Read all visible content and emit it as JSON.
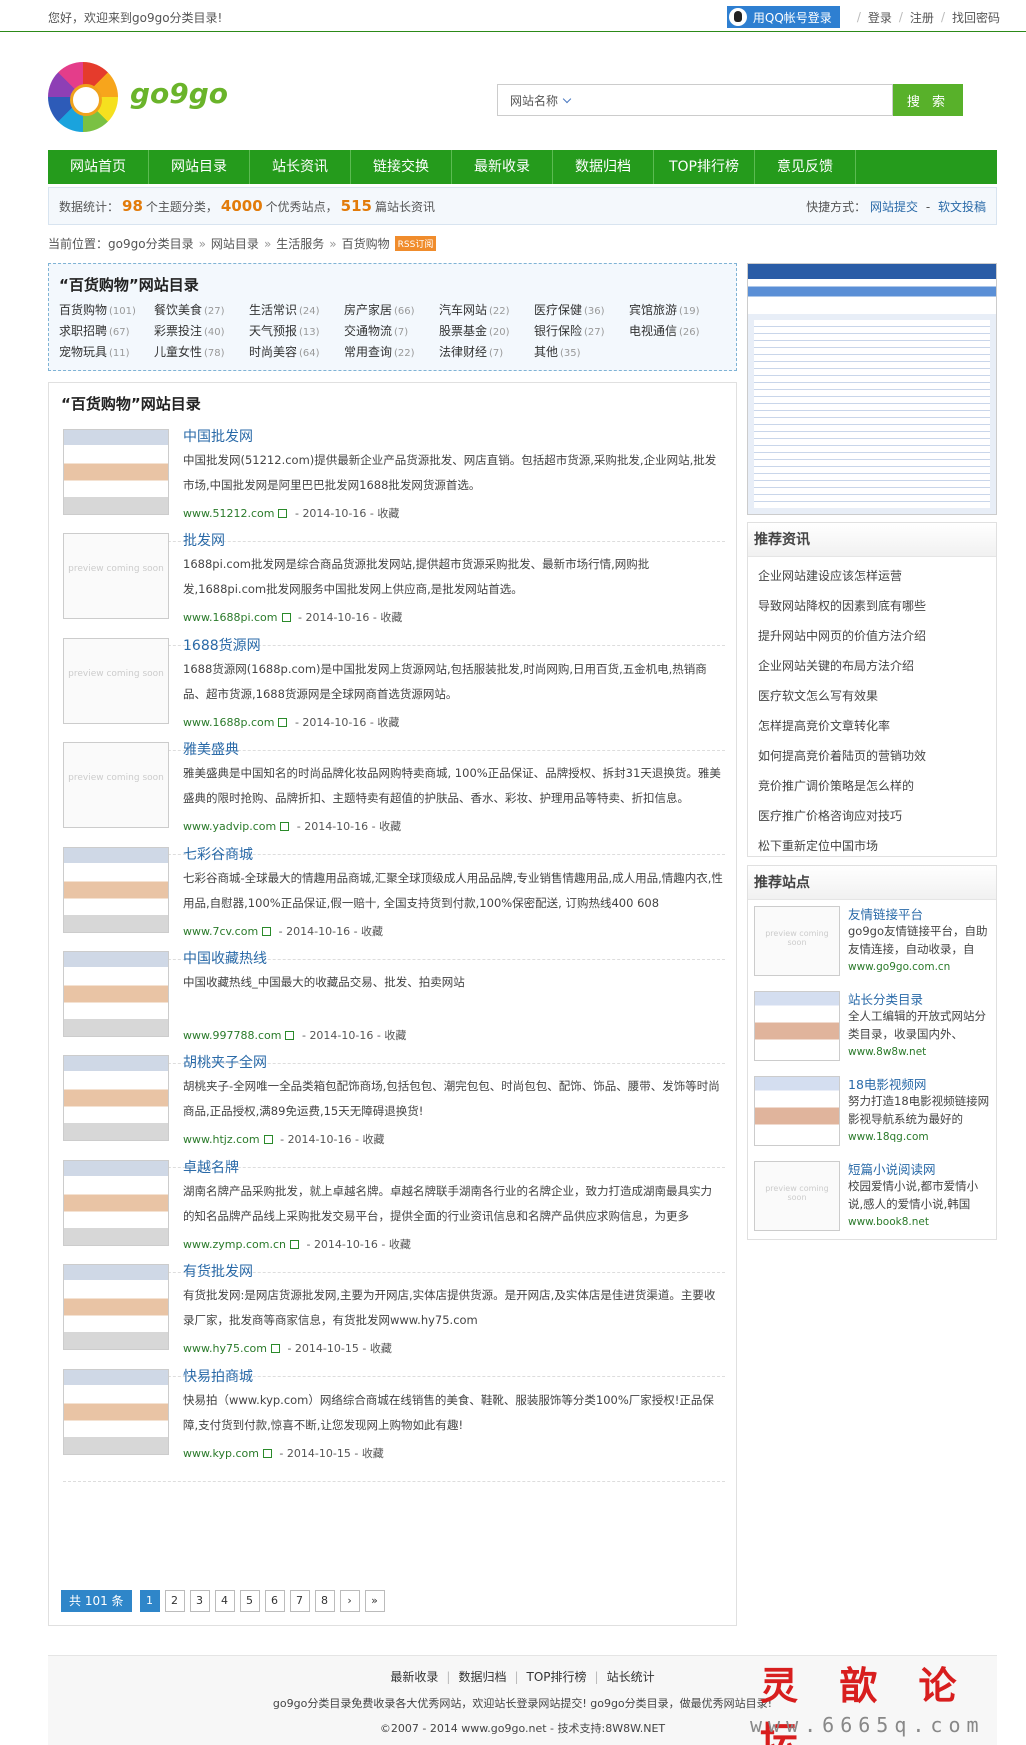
{
  "topbar": {
    "welcome": "您好，欢迎来到go9go分类目录!",
    "qq_login": "用QQ帐号登录",
    "login": "登录",
    "register": "注册",
    "forgot": "找回密码"
  },
  "logo": {
    "text": "go9go"
  },
  "search": {
    "category": "网站名称",
    "placeholder": "",
    "button": "搜 索"
  },
  "nav": [
    "网站首页",
    "网站目录",
    "站长资讯",
    "链接交换",
    "最新收录",
    "数据归档",
    "TOP排行榜",
    "意见反馈"
  ],
  "stats": {
    "label": "数据统计：",
    "categories": "98",
    "categories_text": "个主题分类，",
    "sites": "4000",
    "sites_text": "个优秀站点，",
    "articles": "515",
    "articles_text": "篇站长资讯",
    "quick_label": "快捷方式：",
    "quick_submit": "网站提交",
    "quick_dash": "-",
    "quick_article": "软文投稿"
  },
  "breadcrumb": {
    "label": "当前位置：",
    "items": [
      "go9go分类目录",
      "网站目录",
      "生活服务",
      "百货购物"
    ],
    "badge": "RSS订阅"
  },
  "categories": {
    "title": "“百货购物”网站目录",
    "items": [
      {
        "name": "百货购物",
        "count": "(101)"
      },
      {
        "name": "餐饮美食",
        "count": "(27)"
      },
      {
        "name": "生活常识",
        "count": "(24)"
      },
      {
        "name": "房产家居",
        "count": "(66)"
      },
      {
        "name": "汽车网站",
        "count": "(22)"
      },
      {
        "name": "医疗保健",
        "count": "(36)"
      },
      {
        "name": "宾馆旅游",
        "count": "(19)"
      },
      {
        "name": "求职招聘",
        "count": "(67)"
      },
      {
        "name": "彩票投注",
        "count": "(40)"
      },
      {
        "name": "天气预报",
        "count": "(13)"
      },
      {
        "name": "交通物流",
        "count": "(7)"
      },
      {
        "name": "股票基金",
        "count": "(20)"
      },
      {
        "name": "银行保险",
        "count": "(27)"
      },
      {
        "name": "电视通信",
        "count": "(26)"
      },
      {
        "name": "宠物玩具",
        "count": "(11)"
      },
      {
        "name": "儿童女性",
        "count": "(78)"
      },
      {
        "name": "时尚美容",
        "count": "(64)"
      },
      {
        "name": "常用查询",
        "count": "(22)"
      },
      {
        "name": "法律财经",
        "count": "(7)"
      },
      {
        "name": "其他",
        "count": "(35)"
      }
    ]
  },
  "list": {
    "title": "“百货购物”网站目录",
    "preview_text": "preview coming soon",
    "collect": "收藏",
    "entries": [
      {
        "title": "中国批发网",
        "desc": "中国批发网(51212.com)提供最新企业产品货源批发、网店直销。包括超市货源,采购批发,企业网站,批发市场,中国批发网是阿里巴巴批发网1688批发网货源首选。",
        "url": "www.51212.com",
        "date": "2014-10-16",
        "thumb": "shot"
      },
      {
        "title": "批发网",
        "desc": "1688pi.com批发网是综合商品货源批发网站,提供超市货源采购批发、最新市场行情,网购批发,1688pi.com批发网服务中国批发网上供应商,是批发网站首选。",
        "url": "www.1688pi.com",
        "date": "2014-10-16",
        "thumb": "preview"
      },
      {
        "title": "1688货源网",
        "desc": "1688货源网(1688p.com)是中国批发网上货源网站,包括服装批发,时尚网购,日用百货,五金机电,热销商品、超市货源,1688货源网是全球网商首选货源网站。",
        "url": "www.1688p.com",
        "date": "2014-10-16",
        "thumb": "preview"
      },
      {
        "title": "雅美盛典",
        "desc": "雅美盛典是中国知名的时尚品牌化妆品网购特卖商城, 100%正品保证、品牌授权、拆封31天退换货。雅美盛典的限时抢购、品牌折扣、主题特卖有超值的护肤品、香水、彩妆、护理用品等特卖、折扣信息。",
        "url": "www.yadvip.com",
        "date": "2014-10-16",
        "thumb": "preview"
      },
      {
        "title": "七彩谷商城",
        "desc": "七彩谷商城-全球最大的情趣用品商城,汇聚全球顶级成人用品品牌,专业销售情趣用品,成人用品,情趣内衣,性用品,自慰器,100%正品保证,假一赔十, 全国支持货到付款,100%保密配送, 订购热线400 608",
        "url": "www.7cv.com",
        "date": "2014-10-16",
        "thumb": "shot"
      },
      {
        "title": "中国收藏热线",
        "desc": "中国收藏热线_中国最大的收藏品交易、批发、拍卖网站",
        "url": "www.997788.com",
        "date": "2014-10-16",
        "thumb": "shot"
      },
      {
        "title": "胡桃夹子全网",
        "desc": "胡桃夹子-全网唯一全品类箱包配饰商场,包括包包、潮完包包、时尚包包、配饰、饰品、腰带、发饰等时尚商品,正品授权,满89免运费,15天无障碍退换货!",
        "url": "www.htjz.com",
        "date": "2014-10-16",
        "thumb": "shot"
      },
      {
        "title": "卓越名牌",
        "desc": "湖南名牌产品采购批发，就上卓越名牌。卓越名牌联手湖南各行业的名牌企业，致力打造成湖南最具实力的知名品牌产品线上采购批发交易平台，提供全面的行业资讯信息和名牌产品供应求购信息，为更多",
        "url": "www.zymp.com.cn",
        "date": "2014-10-16",
        "thumb": "shot"
      },
      {
        "title": "有货批发网",
        "desc": "有货批发网:是网店货源批发网,主要为开网店,实体店提供货源。是开网店,及实体店是佳进货渠道。主要收录厂家，批发商等商家信息，有货批发网www.hy75.com",
        "url": "www.hy75.com",
        "date": "2014-10-15",
        "thumb": "shot"
      },
      {
        "title": "快易拍商城",
        "desc": "快易拍（www.kyp.com）网络综合商城在线销售的美食、鞋靴、服装服饰等分类100%厂家授权!正品保障,支付货到付款,惊喜不断,让您发现网上购物如此有趣!",
        "url": "www.kyp.com",
        "date": "2014-10-15",
        "thumb": "shot"
      }
    ]
  },
  "pagination": {
    "total": "共 101 条",
    "pages": [
      "1",
      "2",
      "3",
      "4",
      "5",
      "6",
      "7",
      "8"
    ],
    "next": "›",
    "last": "»"
  },
  "news": {
    "title": "推荐资讯",
    "items": [
      "企业网站建设应该怎样运营",
      "导致网站降权的因素到底有哪些",
      "提升网站中网页的价值方法介绍",
      "企业网站关键的布局方法介绍",
      "医疗软文怎么写有效果",
      "怎样提高竞价文章转化率",
      "如何提高竞价着陆页的营销功效",
      "竞价推广调价策略是怎么样的",
      "医疗推广价格咨询应对技巧",
      "松下重新定位中国市场"
    ]
  },
  "recommended_sites": {
    "title": "推荐站点",
    "items": [
      {
        "name": "友情链接平台",
        "desc": "go9go友情链接平台，自助友情连接，自动收录，自",
        "url": "www.go9go.com.cn",
        "thumb": "preview"
      },
      {
        "name": "站长分类目录",
        "desc": "全人工编辑的开放式网站分类目录，收录国内外、",
        "url": "www.8w8w.net",
        "thumb": "shot"
      },
      {
        "name": "18电影视频网",
        "desc": "努力打造18电影视频链接网影视导航系统为最好的",
        "url": "www.18qg.com",
        "thumb": "shot"
      },
      {
        "name": "短篇小说阅读网",
        "desc": "校园爱情小说,都市爱情小说,感人的爱情小说,韩国",
        "url": "www.book8.net",
        "thumb": "preview"
      }
    ]
  },
  "footer": {
    "links": [
      "最新收录",
      "数据归档",
      "TOP排行榜",
      "站长统计"
    ],
    "desc": "go9go分类目录免费收录各大优秀网站，欢迎站长登录网站提交! go9go分类目录，做最优秀网站目录!",
    "copyright": "©2007 - 2014 www.go9go.net - 技术支持:8W8W.NET"
  },
  "watermark": {
    "title": "灵 歆 论 坛",
    "url": "www.6665q.com"
  }
}
